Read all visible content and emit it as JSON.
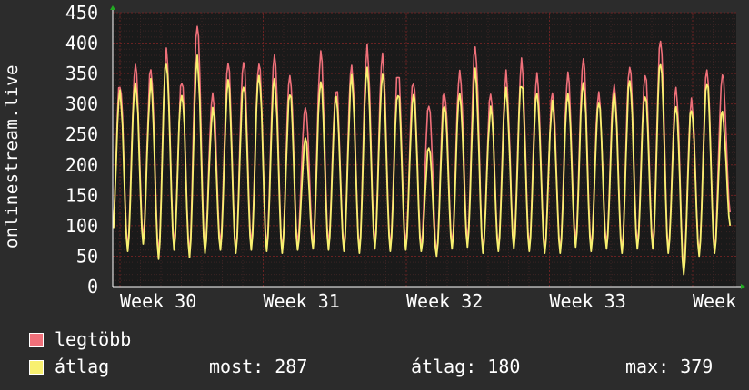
{
  "chart_data": {
    "type": "line",
    "title": "",
    "ylabel": "onlinestream.live",
    "xlabel": "",
    "ylim": [
      0,
      450
    ],
    "yticks": [
      0,
      50,
      100,
      150,
      200,
      250,
      300,
      350,
      400,
      450
    ],
    "xtick_labels": [
      "Week 30",
      "Week 31",
      "Week 32",
      "Week 33",
      "Week"
    ],
    "grid": true,
    "colors": {
      "background": "#2c2c2c",
      "plot_bg": "#1a1a1a",
      "grid": "#5a1e1e",
      "axis": "#ffffff",
      "max_series": "#f0707a",
      "avg_series": "#f8f070"
    },
    "series": [
      {
        "name": "legtöbb",
        "peaks": [
          335,
          365,
          358,
          388,
          339,
          430,
          320,
          365,
          370,
          371,
          375,
          345,
          300,
          380,
          328,
          365,
          390,
          378,
          352,
          340,
          305,
          325,
          358,
          390,
          313,
          350,
          367,
          345,
          316,
          345,
          370,
          315,
          330,
          362,
          348,
          410,
          320,
          308,
          355,
          350
        ],
        "troughs": [
          65,
          80,
          55,
          70,
          55,
          60,
          70,
          60,
          70,
          65,
          60,
          70,
          70,
          70,
          65,
          60,
          70,
          65,
          70,
          65,
          55,
          70,
          75,
          60,
          65,
          70,
          65,
          60,
          60,
          75,
          65,
          70,
          60,
          70,
          70,
          60,
          30,
          55,
          60
        ]
      },
      {
        "name": "átlag",
        "peaks": [
          315,
          338,
          335,
          372,
          322,
          372,
          287,
          335,
          335,
          348,
          340,
          318,
          240,
          335,
          308,
          340,
          355,
          350,
          320,
          318,
          228,
          298,
          320,
          350,
          292,
          322,
          337,
          320,
          300,
          315,
          340,
          300,
          310,
          338,
          320,
          372,
          300,
          292,
          340,
          287
        ],
        "troughs": [
          58,
          70,
          45,
          60,
          48,
          55,
          60,
          55,
          60,
          58,
          55,
          60,
          62,
          60,
          58,
          55,
          62,
          58,
          60,
          58,
          50,
          62,
          65,
          55,
          58,
          62,
          58,
          55,
          55,
          65,
          58,
          62,
          55,
          62,
          62,
          55,
          20,
          50,
          55
        ]
      }
    ]
  },
  "legend": {
    "items": [
      {
        "label": "legtöbb",
        "color": "#f0707a"
      },
      {
        "label": "átlag",
        "color": "#f8f070"
      }
    ]
  },
  "stats": {
    "most": "most: 287",
    "atlag": "átlag: 180",
    "max": "max: 379"
  }
}
